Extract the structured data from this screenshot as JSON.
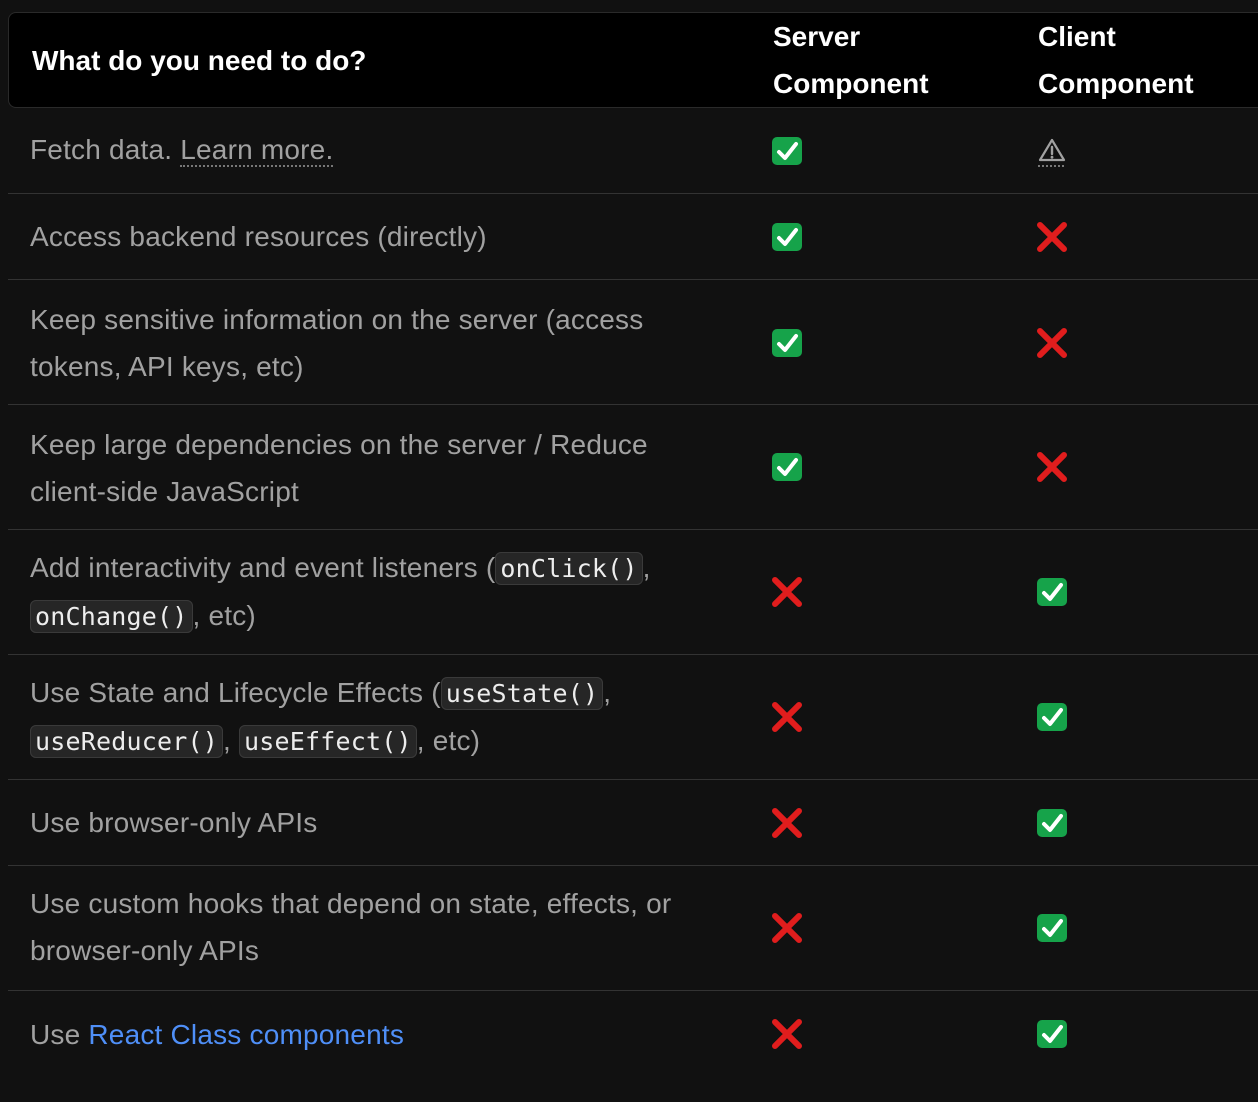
{
  "header": {
    "task": "What do you need to do?",
    "server": "Server Component",
    "client": "Client Component"
  },
  "rows": [
    {
      "task": {
        "text": "Fetch data. ",
        "link": "Learn more."
      },
      "server": "check-icon",
      "client": "warning-icon"
    },
    {
      "task": {
        "text": "Access backend resources (directly)"
      },
      "server": "check-icon",
      "client": "cross-icon"
    },
    {
      "task": {
        "text": "Keep sensitive information on the server (access tokens, API keys, etc)"
      },
      "server": "check-icon",
      "client": "cross-icon"
    },
    {
      "task": {
        "text": "Keep large dependencies on the server / Reduce client-side JavaScript"
      },
      "server": "check-icon",
      "client": "cross-icon"
    },
    {
      "task": {
        "pre": "Add interactivity and event listeners (",
        "code1": "onClick()",
        "sep1": ",",
        "code2": "onChange()",
        "post": ", etc)"
      },
      "server": "cross-icon",
      "client": "check-icon"
    },
    {
      "task": {
        "pre": "Use State and Lifecycle Effects (",
        "code1": "useState()",
        "sep1": ",",
        "code2": "useReducer()",
        "sep2": ", ",
        "code3": "useEffect()",
        "post": ", etc)"
      },
      "server": "cross-icon",
      "client": "check-icon"
    },
    {
      "task": {
        "text": "Use browser-only APIs"
      },
      "server": "cross-icon",
      "client": "check-icon"
    },
    {
      "task": {
        "text": "Use custom hooks that depend on state, effects, or browser-only APIs"
      },
      "server": "cross-icon",
      "client": "check-icon"
    },
    {
      "task": {
        "text": "Use ",
        "link": "React Class components"
      },
      "server": "cross-icon",
      "client": "check-icon"
    }
  ],
  "colors": {
    "check_bg": "#16a34a",
    "cross": "#e11d1d",
    "link": "#4f8ff7"
  }
}
